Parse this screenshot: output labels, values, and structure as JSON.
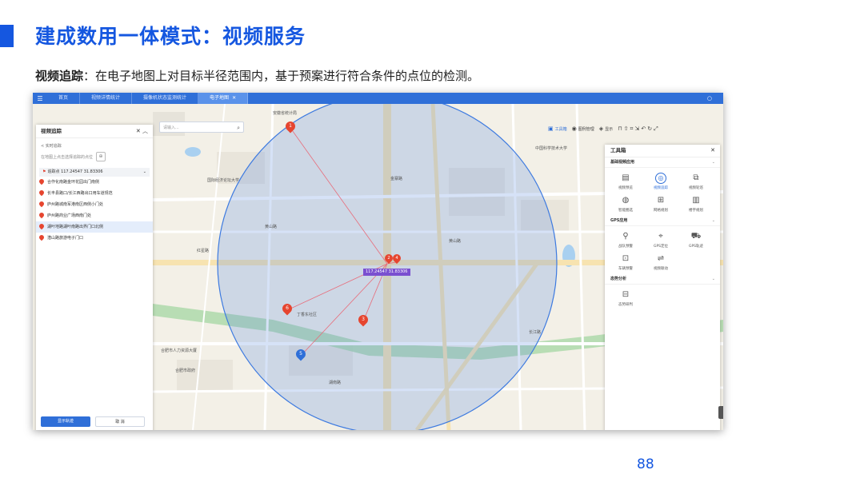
{
  "slide": {
    "title": "建成数用一体模式：视频服务",
    "subtitle_bold": "视频追踪",
    "subtitle_rest": "：在电子地图上对目标半径范围内，基于预案进行符合条件的点位的检测。",
    "page_number": "88",
    "accent_color": "#1557e0"
  },
  "app": {
    "menu_icon": "grid-menu-icon",
    "tabs": [
      {
        "label": "首页",
        "active": false
      },
      {
        "label": "视频详情统计",
        "active": false
      },
      {
        "label": "摄像机状态监测统计",
        "active": false
      },
      {
        "label": "电子地图",
        "active": true
      }
    ],
    "tab_right": "○"
  },
  "map": {
    "search_placeholder": "请输入...",
    "toolbar": [
      {
        "label": "工具箱",
        "icon": "toolbox-icon",
        "active": true
      },
      {
        "label": "图例管理",
        "icon": "legend-icon",
        "active": false
      },
      {
        "label": "显示",
        "icon": "layers-icon",
        "active": false
      }
    ],
    "center_label": "117.24547 31.83306",
    "labels": [
      {
        "text": "安徽省统计局"
      },
      {
        "text": "国际经济论坛大学"
      },
      {
        "text": "黄山路"
      },
      {
        "text": "合肥市人力资源大厦"
      },
      {
        "text": "合肥市政府"
      },
      {
        "text": "丁香东社区"
      },
      {
        "text": "中国科学技术大学"
      },
      {
        "text": "黄山路"
      },
      {
        "text": "金寨路"
      },
      {
        "text": "长江路"
      },
      {
        "text": "湖南路"
      },
      {
        "text": "红星路"
      }
    ]
  },
  "left_panel": {
    "title": "视频追踪",
    "back_label": "< 实时追踪",
    "hint": "在地图上点击选择追踪的点位",
    "center_point": "追踪点 117.24547 31.83306",
    "items": [
      {
        "label": "合作化南路金环花园出门南侧",
        "selected": false
      },
      {
        "label": "长丰县路口/长江西路出口用车道规范",
        "selected": false
      },
      {
        "label": "庐州路城南军港南区西侧小门处",
        "selected": false
      },
      {
        "label": "庐州路商业广场西南门处",
        "selected": false
      },
      {
        "label": "湖叶地路湖叶南路出界门口北侧",
        "selected": true
      },
      {
        "label": "潜山路旅游电子门口",
        "selected": false
      }
    ],
    "primary_button": "显示轨迹",
    "secondary_button": "取 消"
  },
  "toolbox": {
    "title": "工具箱",
    "sections": [
      {
        "title": "基础视频应用",
        "tools": [
          {
            "label": "视频预览",
            "icon": "video-preview-icon",
            "active": false
          },
          {
            "label": "视频追踪",
            "icon": "video-track-icon",
            "active": true
          },
          {
            "label": "视频轮巡",
            "icon": "video-patrol-icon",
            "active": false
          },
          {
            "label": "智能圈选",
            "icon": "smart-select-icon",
            "active": false
          },
          {
            "label": "网格规划",
            "icon": "grid-plan-icon",
            "active": false
          },
          {
            "label": "楼宇规划",
            "icon": "building-icon",
            "active": false
          }
        ]
      },
      {
        "title": "GPS应用",
        "tools": [
          {
            "label": "战队预警",
            "icon": "bike-icon",
            "active": false
          },
          {
            "label": "GPS定位",
            "icon": "gps-pin-icon",
            "active": false
          },
          {
            "label": "GPS轨迹",
            "icon": "gps-track-icon",
            "active": false
          },
          {
            "label": "车辆预警",
            "icon": "vehicle-alert-icon",
            "active": false
          },
          {
            "label": "视频联动",
            "icon": "video-link-icon",
            "active": false
          }
        ]
      },
      {
        "title": "态势分析",
        "tools": [
          {
            "label": "态势研判",
            "icon": "situation-icon",
            "active": false
          }
        ]
      }
    ]
  },
  "markers": [
    {
      "number": "1"
    },
    {
      "number": "2"
    },
    {
      "number": "3"
    },
    {
      "number": "4"
    },
    {
      "number": "5"
    },
    {
      "number": "6"
    }
  ]
}
